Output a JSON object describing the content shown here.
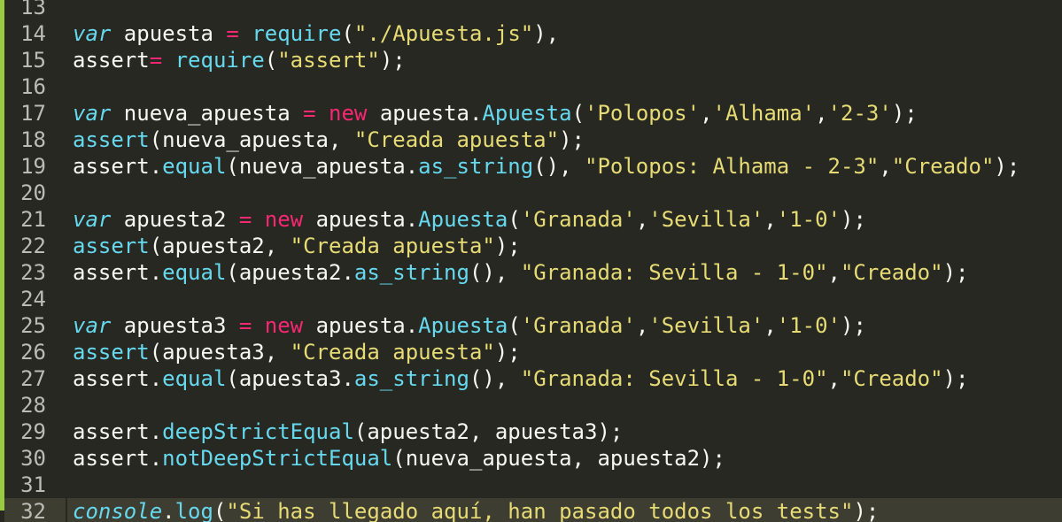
{
  "editor": {
    "theme_colors": {
      "background": "#272822",
      "gutter_marker": "#9bc940",
      "keyword": "#66d9ef",
      "operator": "#f92672",
      "string": "#e6db74",
      "text": "#f8f8f2",
      "line_number": "#bcbcb6",
      "active_line": "#3e3d32"
    },
    "active_line": "32",
    "lines": [
      {
        "n": "13",
        "tokens": []
      },
      {
        "n": "14",
        "tokens": [
          {
            "t": "kw",
            "v": "var"
          },
          {
            "t": "id",
            "v": " apuesta "
          },
          {
            "t": "op",
            "v": "="
          },
          {
            "t": "id",
            "v": " "
          },
          {
            "t": "fn",
            "v": "require"
          },
          {
            "t": "p",
            "v": "("
          },
          {
            "t": "str",
            "v": "\"./Apuesta.js\""
          },
          {
            "t": "p",
            "v": "),"
          }
        ]
      },
      {
        "n": "15",
        "tokens": [
          {
            "t": "id",
            "v": "assert"
          },
          {
            "t": "op",
            "v": "="
          },
          {
            "t": "id",
            "v": " "
          },
          {
            "t": "fn",
            "v": "require"
          },
          {
            "t": "p",
            "v": "("
          },
          {
            "t": "str",
            "v": "\"assert\""
          },
          {
            "t": "p",
            "v": ");"
          }
        ]
      },
      {
        "n": "16",
        "tokens": []
      },
      {
        "n": "17",
        "tokens": [
          {
            "t": "kw",
            "v": "var"
          },
          {
            "t": "id",
            "v": " nueva_apuesta "
          },
          {
            "t": "op",
            "v": "="
          },
          {
            "t": "id",
            "v": " "
          },
          {
            "t": "op",
            "v": "new"
          },
          {
            "t": "id",
            "v": " apuesta."
          },
          {
            "t": "fn",
            "v": "Apuesta"
          },
          {
            "t": "p",
            "v": "("
          },
          {
            "t": "str",
            "v": "'Polopos'"
          },
          {
            "t": "p",
            "v": ","
          },
          {
            "t": "str",
            "v": "'Alhama'"
          },
          {
            "t": "p",
            "v": ","
          },
          {
            "t": "str",
            "v": "'2-3'"
          },
          {
            "t": "p",
            "v": ");"
          }
        ]
      },
      {
        "n": "18",
        "tokens": [
          {
            "t": "fn",
            "v": "assert"
          },
          {
            "t": "p",
            "v": "(nueva_apuesta, "
          },
          {
            "t": "str",
            "v": "\"Creada apuesta\""
          },
          {
            "t": "p",
            "v": ");"
          }
        ]
      },
      {
        "n": "19",
        "tokens": [
          {
            "t": "id",
            "v": "assert."
          },
          {
            "t": "fn",
            "v": "equal"
          },
          {
            "t": "p",
            "v": "(nueva_apuesta."
          },
          {
            "t": "fn",
            "v": "as_string"
          },
          {
            "t": "p",
            "v": "(), "
          },
          {
            "t": "str",
            "v": "\"Polopos: Alhama - 2-3\""
          },
          {
            "t": "p",
            "v": ","
          },
          {
            "t": "str",
            "v": "\"Creado\""
          },
          {
            "t": "p",
            "v": ");"
          }
        ]
      },
      {
        "n": "20",
        "tokens": []
      },
      {
        "n": "21",
        "tokens": [
          {
            "t": "kw",
            "v": "var"
          },
          {
            "t": "id",
            "v": " apuesta2 "
          },
          {
            "t": "op",
            "v": "="
          },
          {
            "t": "id",
            "v": " "
          },
          {
            "t": "op",
            "v": "new"
          },
          {
            "t": "id",
            "v": " apuesta."
          },
          {
            "t": "fn",
            "v": "Apuesta"
          },
          {
            "t": "p",
            "v": "("
          },
          {
            "t": "str",
            "v": "'Granada'"
          },
          {
            "t": "p",
            "v": ","
          },
          {
            "t": "str",
            "v": "'Sevilla'"
          },
          {
            "t": "p",
            "v": ","
          },
          {
            "t": "str",
            "v": "'1-0'"
          },
          {
            "t": "p",
            "v": ");"
          }
        ]
      },
      {
        "n": "22",
        "tokens": [
          {
            "t": "fn",
            "v": "assert"
          },
          {
            "t": "p",
            "v": "(apuesta2, "
          },
          {
            "t": "str",
            "v": "\"Creada apuesta\""
          },
          {
            "t": "p",
            "v": ");"
          }
        ]
      },
      {
        "n": "23",
        "tokens": [
          {
            "t": "id",
            "v": "assert."
          },
          {
            "t": "fn",
            "v": "equal"
          },
          {
            "t": "p",
            "v": "(apuesta2."
          },
          {
            "t": "fn",
            "v": "as_string"
          },
          {
            "t": "p",
            "v": "(), "
          },
          {
            "t": "str",
            "v": "\"Granada: Sevilla - 1-0\""
          },
          {
            "t": "p",
            "v": ","
          },
          {
            "t": "str",
            "v": "\"Creado\""
          },
          {
            "t": "p",
            "v": ");"
          }
        ]
      },
      {
        "n": "24",
        "tokens": []
      },
      {
        "n": "25",
        "tokens": [
          {
            "t": "kw",
            "v": "var"
          },
          {
            "t": "id",
            "v": " apuesta3 "
          },
          {
            "t": "op",
            "v": "="
          },
          {
            "t": "id",
            "v": " "
          },
          {
            "t": "op",
            "v": "new"
          },
          {
            "t": "id",
            "v": " apuesta."
          },
          {
            "t": "fn",
            "v": "Apuesta"
          },
          {
            "t": "p",
            "v": "("
          },
          {
            "t": "str",
            "v": "'Granada'"
          },
          {
            "t": "p",
            "v": ","
          },
          {
            "t": "str",
            "v": "'Sevilla'"
          },
          {
            "t": "p",
            "v": ","
          },
          {
            "t": "str",
            "v": "'1-0'"
          },
          {
            "t": "p",
            "v": ");"
          }
        ]
      },
      {
        "n": "26",
        "tokens": [
          {
            "t": "fn",
            "v": "assert"
          },
          {
            "t": "p",
            "v": "(apuesta3, "
          },
          {
            "t": "str",
            "v": "\"Creada apuesta\""
          },
          {
            "t": "p",
            "v": ");"
          }
        ]
      },
      {
        "n": "27",
        "tokens": [
          {
            "t": "id",
            "v": "assert."
          },
          {
            "t": "fn",
            "v": "equal"
          },
          {
            "t": "p",
            "v": "(apuesta3."
          },
          {
            "t": "fn",
            "v": "as_string"
          },
          {
            "t": "p",
            "v": "(), "
          },
          {
            "t": "str",
            "v": "\"Granada: Sevilla - 1-0\""
          },
          {
            "t": "p",
            "v": ","
          },
          {
            "t": "str",
            "v": "\"Creado\""
          },
          {
            "t": "p",
            "v": ");"
          }
        ]
      },
      {
        "n": "28",
        "tokens": []
      },
      {
        "n": "29",
        "tokens": [
          {
            "t": "id",
            "v": "assert."
          },
          {
            "t": "fn",
            "v": "deepStrictEqual"
          },
          {
            "t": "p",
            "v": "(apuesta2, apuesta3);"
          }
        ]
      },
      {
        "n": "30",
        "tokens": [
          {
            "t": "id",
            "v": "assert."
          },
          {
            "t": "fn",
            "v": "notDeepStrictEqual"
          },
          {
            "t": "p",
            "v": "(nueva_apuesta, apuesta2);"
          }
        ]
      },
      {
        "n": "31",
        "tokens": []
      },
      {
        "n": "32",
        "tokens": [
          {
            "t": "bl",
            "v": "console"
          },
          {
            "t": "p",
            "v": "."
          },
          {
            "t": "fn",
            "v": "log"
          },
          {
            "t": "p",
            "v": "("
          },
          {
            "t": "str",
            "v": "\"Si has llegado aquí, han pasado todos los tests\""
          },
          {
            "t": "p",
            "v": ");"
          }
        ]
      }
    ]
  }
}
